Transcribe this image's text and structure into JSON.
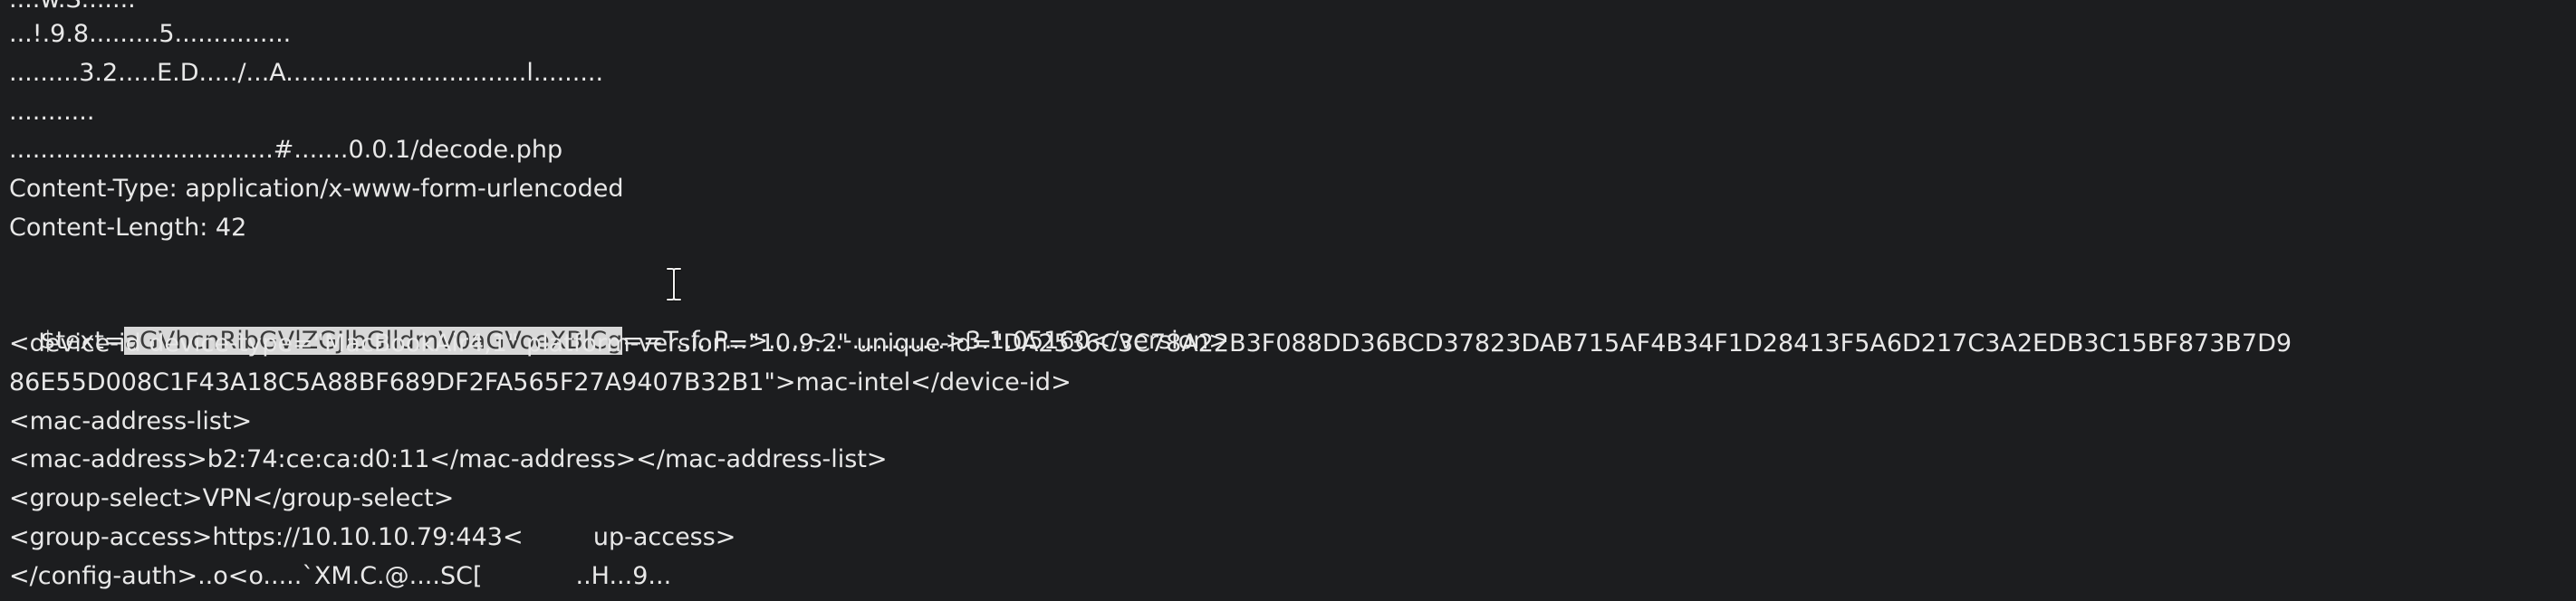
{
  "terminal": {
    "lines": [
      "....w.S.......",
      "...!.9.8.........5...............",
      ".........3.2.....E.D...../...A...............................l.........",
      "...........",
      "..................................#.......0.0.1/decode.php",
      "Content-Type: application/x-www-form-urlencoded",
      "Content-Length: 42",
      "",
      {
        "prefix": "$text=",
        "selected": "aGVhcnRibGVlZGJlbGlldmV0aGVoeXBlCg",
        "suffix": "==T..f..P...>.....~..-............>3.1.05160</version>"
      },
      "<device-id device-type=\"MacBookAir4,1\" platform-version=\"10.9.2\" unique-id=\"DA2536C3C78A22B3F088DD36BCD37823DAB715AF4B34F1D28413F5A6D217C3A2EDB3C15BF873B7D9",
      "86E55D008C1F43A18C5A88BF689DF2FA565F27A9407B32B1\">mac-intel</device-id>",
      "<mac-address-list>",
      "<mac-address>b2:74:ce:ca:d0:11</mac-address></mac-address-list>",
      "<group-select>VPN</group-select>",
      "<group-access>https://10.10.10.79:443<         up-access>",
      "</config-auth>..o<o.....`XM.C.@....SC[            ..H...9..."
    ]
  },
  "colors": {
    "background": "#1c1d1f",
    "text": "#e8e8e8",
    "selection_bg": "#d8d8d8",
    "selection_text": "#3a3a3a"
  },
  "icons": {
    "cursor": "text-ibeam-cursor-icon"
  }
}
